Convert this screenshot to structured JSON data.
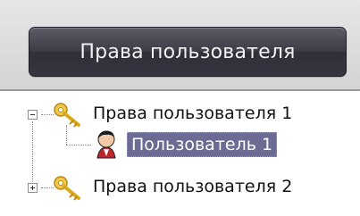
{
  "header": {
    "title_button_label": "Права пользователя"
  },
  "tree": {
    "nodes": [
      {
        "label": "Права пользователя 1",
        "expanded": true,
        "icon": "key-icon"
      },
      {
        "label": "Пользователь 1",
        "selected": true,
        "icon": "user-icon"
      },
      {
        "label": "Права пользователя 2",
        "expanded": false,
        "icon": "key-icon"
      }
    ]
  },
  "colors": {
    "button_bg": "#3d3d47",
    "selection_bg": "#6b6b93",
    "key_gold": "#e8b81e"
  }
}
